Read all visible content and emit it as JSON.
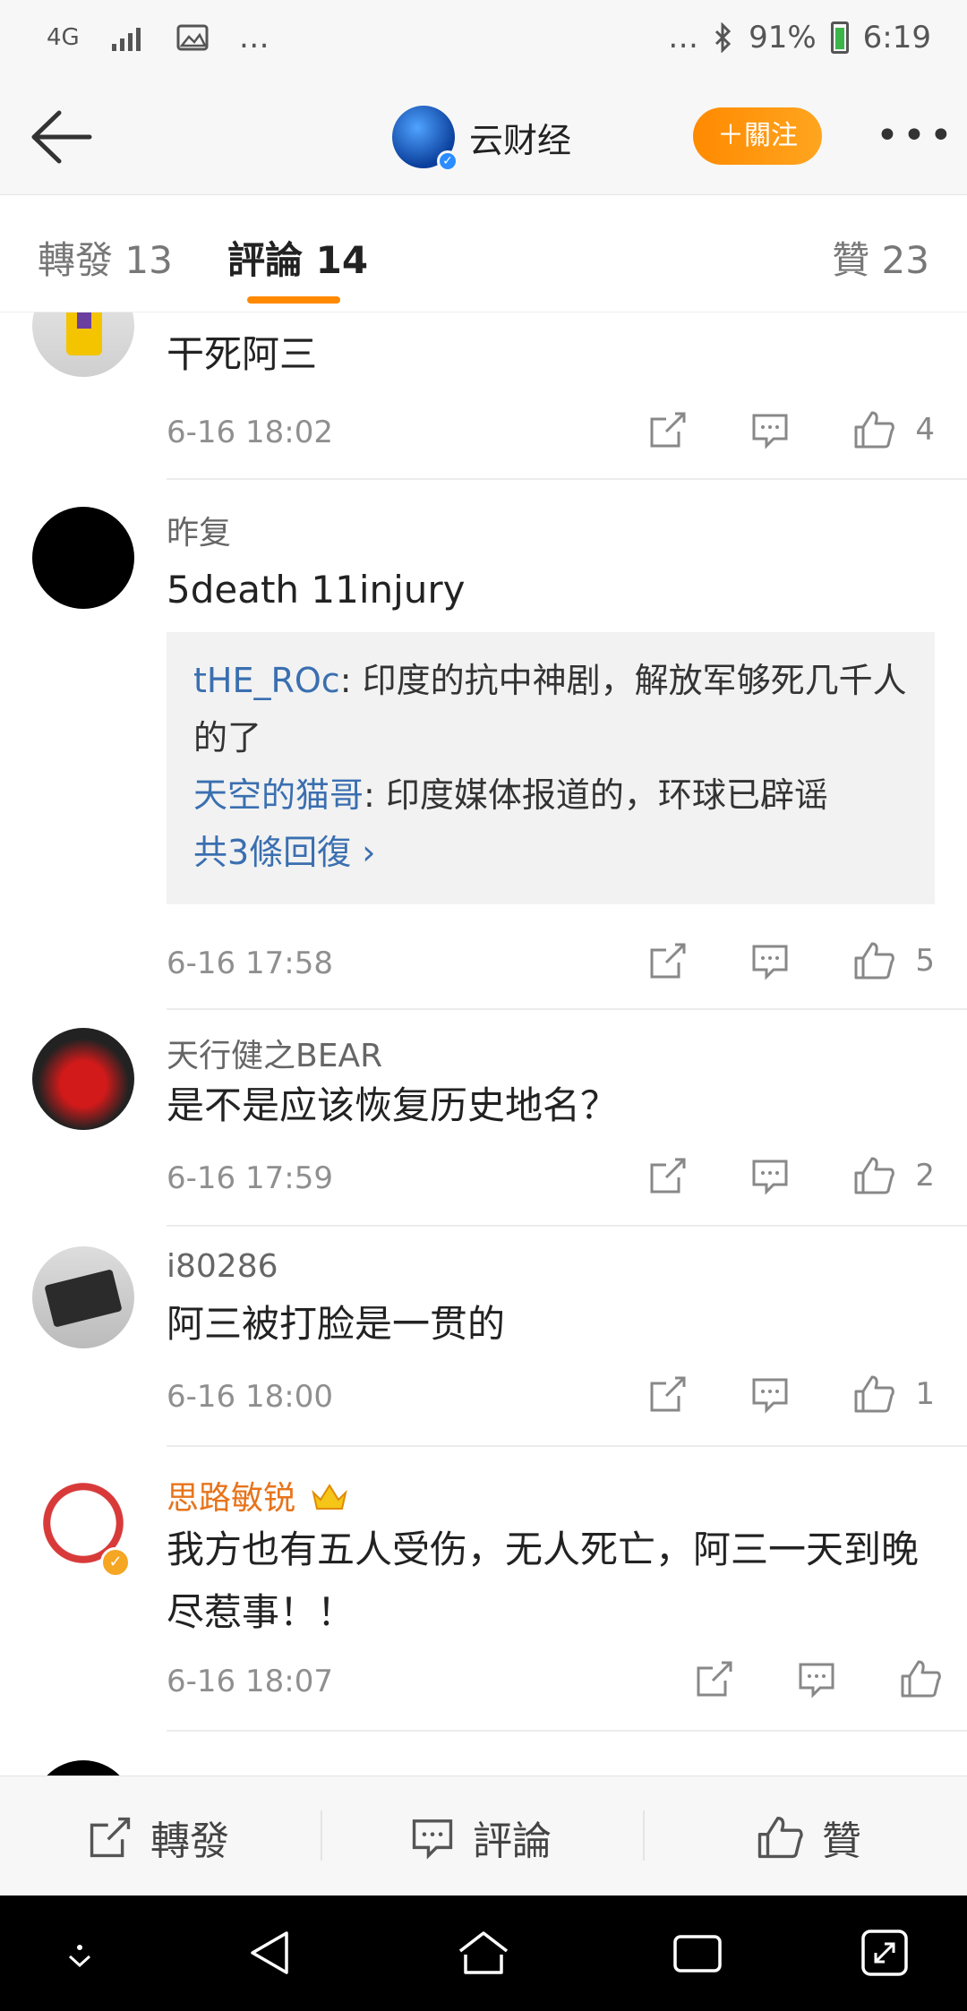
{
  "status_bar": {
    "network": "4G",
    "extra": "…",
    "right_dots": "…",
    "battery": "91%",
    "time": "6:19"
  },
  "nav": {
    "brand_name": "云财经",
    "follow_label": "＋關注",
    "more": "•••"
  },
  "tabs": [
    {
      "label": "轉發 13"
    },
    {
      "label": "評論 14"
    },
    {
      "label": "贊 23"
    }
  ],
  "comments": [
    {
      "text": "干死阿三",
      "time": "6-16 18:02",
      "likes": "4"
    },
    {
      "name": "昨复",
      "text": "5death 11injury",
      "replies": [
        {
          "name": "tHE_ROc",
          "text": ": 印度的抗中神剧，解放军够死几千人的了"
        },
        {
          "name": "天空的猫哥",
          "text": ": 印度媒体报道的，环球已辟谣"
        }
      ],
      "more_replies": "共3條回復 ›",
      "time": "6-16 17:58",
      "likes": "5"
    },
    {
      "name": "天行健之BEAR",
      "text": "是不是应该恢复历史地名？",
      "time": "6-16 17:59",
      "likes": "2"
    },
    {
      "name": "i80286",
      "text": "阿三被打脸是一贯的",
      "time": "6-16 18:00",
      "likes": "1"
    },
    {
      "name": "思路敏锐",
      "text": "我方也有五人受伤，无人死亡，阿三一天到晚尽惹事！！",
      "time": "6-16 18:07",
      "likes": ""
    }
  ],
  "bottom_bar": {
    "repost": "轉發",
    "comment": "評論",
    "like": "贊"
  },
  "colors": {
    "accent": "#ff8a00",
    "link": "#3a6fb0",
    "vip_name": "#e7741b"
  }
}
